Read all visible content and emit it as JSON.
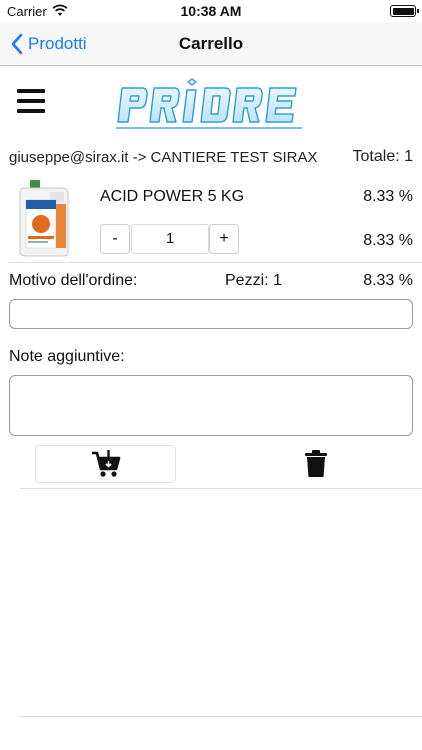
{
  "status_bar": {
    "carrier": "Carrier",
    "time": "10:38 AM"
  },
  "nav": {
    "back_label": "Prodotti",
    "title": "Carrello"
  },
  "header": {
    "logo_text": "PRIORE"
  },
  "order": {
    "recipient": "giuseppe@sirax.it -> CANTIERE TEST SIRAX",
    "total": "Totale: 1"
  },
  "product": {
    "name": "ACID POWER 5 KG",
    "percent_1": "8.33 %",
    "percent_2": "8.33 %",
    "quantity": "1",
    "minus_label": "-",
    "plus_label": "+"
  },
  "summary": {
    "motivo_label": "Motivo dell'ordine:",
    "pezzi": "Pezzi: 1",
    "percent": "8.33 %"
  },
  "note": {
    "label": "Note aggiuntive:"
  },
  "colors": {
    "accent": "#1a7cf5",
    "logo": "#2a9fd8"
  }
}
